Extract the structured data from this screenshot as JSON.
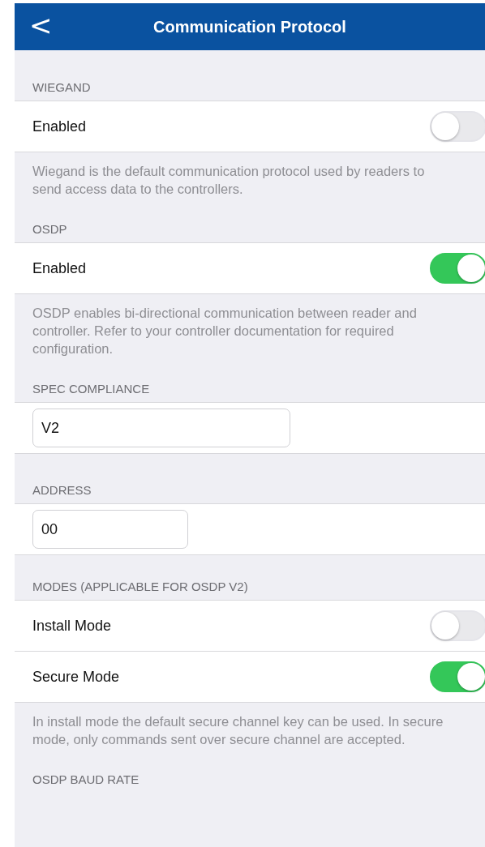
{
  "nav": {
    "back": "<",
    "title": "Communication Protocol"
  },
  "sections": [
    {
      "header": "WIEGAND",
      "rows": [
        {
          "kind": "toggle",
          "label": "Enabled",
          "on": false
        }
      ],
      "note": "Wiegand is the default communication protocol used by readers to send access data to the controllers."
    },
    {
      "header": "OSDP",
      "rows": [
        {
          "kind": "toggle",
          "label": "Enabled",
          "on": true
        }
      ],
      "note": "OSDP enables bi-directional communication between reader and controller. Refer to your controller documentation for required configuration."
    },
    {
      "header": "SPEC COMPLIANCE",
      "rows": [
        {
          "kind": "field",
          "value": "V2"
        }
      ]
    },
    {
      "header": "ADDRESS",
      "rows": [
        {
          "kind": "field",
          "value": "00"
        }
      ]
    },
    {
      "header": "MODES (APPLICABLE FOR OSDP V2)",
      "rows": [
        {
          "kind": "toggle",
          "label": "Install Mode",
          "on": false
        },
        {
          "kind": "toggle",
          "label": "Secure Mode",
          "on": true
        }
      ],
      "note": "In install mode the default secure channel key can be used. In secure mode, only commands sent over secure channel are accepted."
    },
    {
      "header": "OSDP BAUD RATE"
    }
  ]
}
